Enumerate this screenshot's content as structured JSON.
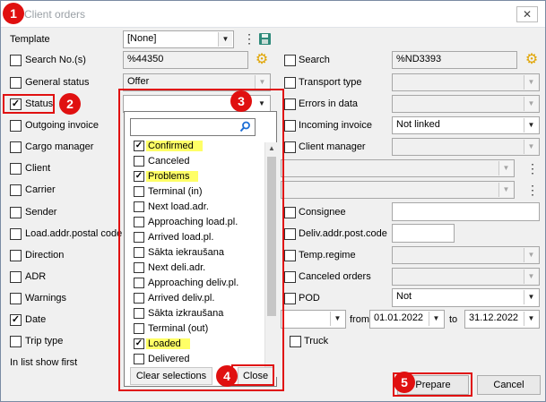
{
  "window": {
    "title": "Client orders",
    "close_glyph": "✕"
  },
  "badges": [
    "1",
    "2",
    "3",
    "4",
    "5"
  ],
  "form": {
    "template": {
      "label": "Template",
      "value": "[None]"
    },
    "search_no": {
      "label": "Search No.(s)",
      "value": "%44350",
      "checked": false
    },
    "search": {
      "label": "Search",
      "value": "%ND3393",
      "checked": false
    },
    "general_status": {
      "label": "General status",
      "value": "Offer",
      "checked": false
    },
    "transport_type": {
      "label": "Transport type",
      "checked": false
    },
    "status": {
      "label": "Status",
      "checked": true
    },
    "errors_in_data": {
      "label": "Errors in data",
      "checked": false
    },
    "outgoing_invoice": {
      "label": "Outgoing invoice",
      "checked": false
    },
    "incoming_invoice": {
      "label": "Incoming invoice",
      "value": "Not linked",
      "checked": false
    },
    "cargo_manager": {
      "label": "Cargo manager",
      "checked": false
    },
    "client_manager": {
      "label": "Client manager",
      "checked": false
    },
    "client": {
      "label": "Client",
      "checked": false
    },
    "carrier": {
      "label": "Carrier",
      "checked": false
    },
    "sender": {
      "label": "Sender",
      "checked": false
    },
    "consignee": {
      "label": "Consignee",
      "checked": false
    },
    "load_addr": {
      "label": "Load.addr.postal code",
      "checked": false
    },
    "deliv_addr": {
      "label": "Deliv.addr.post.code",
      "checked": false
    },
    "direction": {
      "label": "Direction",
      "checked": false
    },
    "temp_regime": {
      "label": "Temp.regime",
      "checked": false
    },
    "adr": {
      "label": "ADR",
      "checked": false
    },
    "canceled_orders": {
      "label": "Canceled orders",
      "checked": false
    },
    "warnings": {
      "label": "Warnings",
      "checked": false
    },
    "pod": {
      "label": "POD",
      "value": "Not",
      "checked": false
    },
    "date": {
      "label": "Date",
      "checked": true,
      "from_label": "from",
      "from": "01.01.2022",
      "to_label": "to",
      "to": "31.12.2022"
    },
    "trip_type": {
      "label": "Trip type",
      "checked": false
    },
    "truck": {
      "label": "Truck",
      "checked": false
    },
    "list_show_first": {
      "label": "In list show first"
    }
  },
  "status_list": {
    "items": [
      {
        "label": "Confirmed",
        "checked": true,
        "highlight": true
      },
      {
        "label": "Canceled",
        "checked": false,
        "highlight": false
      },
      {
        "label": "Problems",
        "checked": true,
        "highlight": true
      },
      {
        "label": "Terminal (in)",
        "checked": false,
        "highlight": false
      },
      {
        "label": "Next load.adr.",
        "checked": false,
        "highlight": false
      },
      {
        "label": "Approaching load.pl.",
        "checked": false,
        "highlight": false
      },
      {
        "label": "Arrived load.pl.",
        "checked": false,
        "highlight": false
      },
      {
        "label": "Sākta iekraušana",
        "checked": false,
        "highlight": false
      },
      {
        "label": "Next deli.adr.",
        "checked": false,
        "highlight": false
      },
      {
        "label": "Approaching deliv.pl.",
        "checked": false,
        "highlight": false
      },
      {
        "label": "Arrived deliv.pl.",
        "checked": false,
        "highlight": false
      },
      {
        "label": "Sākta izkraušana",
        "checked": false,
        "highlight": false
      },
      {
        "label": "Terminal (out)",
        "checked": false,
        "highlight": false
      },
      {
        "label": "Loaded",
        "checked": true,
        "highlight": true
      },
      {
        "label": "Delivered",
        "checked": false,
        "highlight": false
      }
    ],
    "clear_label": "Clear selections",
    "close_label": "Close"
  },
  "buttons": {
    "prepare": "Prepare",
    "cancel": "Cancel"
  },
  "icons": {
    "gear": "gear-icon",
    "save": "save-icon",
    "search": "search-icon"
  },
  "colors": {
    "highlight": "#e01010",
    "marker": "#ffff66"
  }
}
